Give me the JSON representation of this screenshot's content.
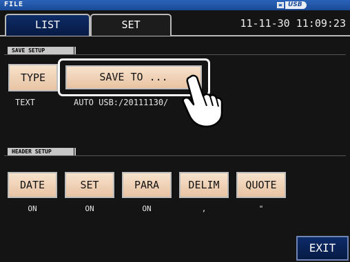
{
  "window": {
    "title": "FILE",
    "usb_label": "USB"
  },
  "tabs": [
    {
      "label": "LIST",
      "active": false
    },
    {
      "label": "SET",
      "active": true
    }
  ],
  "datetime": "11-11-30 11:09:23",
  "save_setup": {
    "section_label": "SAVE SETUP",
    "type_button": "TYPE",
    "type_value": "TEXT",
    "save_to_button": "SAVE TO ...",
    "save_to_value": "AUTO  USB:/20111130/"
  },
  "header_setup": {
    "section_label": "HEADER SETUP",
    "buttons": [
      {
        "label": "DATE",
        "value": "ON"
      },
      {
        "label": "SET",
        "value": "ON"
      },
      {
        "label": "PARA",
        "value": "ON"
      },
      {
        "label": "DELIM",
        "value": ","
      },
      {
        "label": "QUOTE",
        "value": "\""
      }
    ]
  },
  "exit_button": "EXIT",
  "icons": {
    "usb": "usb-icon",
    "pointer": "pointing-hand-icon"
  },
  "colors": {
    "title_bar": "#1f54a8",
    "button_face": "#f0d2b5",
    "exit_button": "#0a2458",
    "background": "#141414"
  }
}
